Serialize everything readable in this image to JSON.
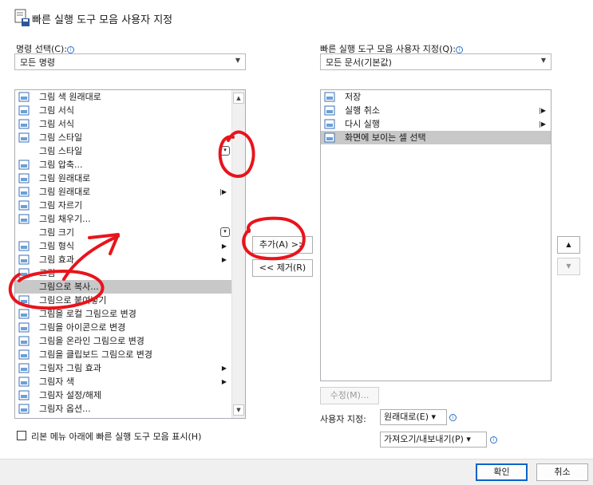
{
  "dialog": {
    "title": "빠른 실행 도구 모음 사용자 지정"
  },
  "left": {
    "label": "명령 선택(C):",
    "dropdown_value": "모든 명령",
    "items": [
      {
        "label": "그림 색 원래대로",
        "icon": "picture-reset-icon",
        "sub": ""
      },
      {
        "label": "그림 서식",
        "icon": "picture-format-icon",
        "sub": ""
      },
      {
        "label": "그림 서식",
        "icon": "format-painter-icon",
        "sub": ""
      },
      {
        "label": "그림 스타일",
        "icon": "picture-style-icon",
        "sub": ""
      },
      {
        "label": "그림 스타일",
        "icon": "",
        "sub": "drop"
      },
      {
        "label": "그림 압축...",
        "icon": "compress-picture-icon",
        "sub": ""
      },
      {
        "label": "그림 원래대로",
        "icon": "picture-reset-icon",
        "sub": ""
      },
      {
        "label": "그림 원래대로",
        "icon": "picture-reset-icon",
        "sub": "split"
      },
      {
        "label": "그림 자르기",
        "icon": "crop-icon",
        "sub": ""
      },
      {
        "label": "그림 채우기...",
        "icon": "picture-fill-icon",
        "sub": ""
      },
      {
        "label": "그림 크기",
        "icon": "",
        "sub": "drop"
      },
      {
        "label": "그림 형식",
        "icon": "picture-layout-icon",
        "sub": "arrow"
      },
      {
        "label": "그림 효과",
        "icon": "picture-effects-icon",
        "sub": "arrow"
      },
      {
        "label": "그림",
        "icon": "picture-icon",
        "sub": ""
      },
      {
        "label": "그림으로 복사...",
        "icon": "",
        "sub": ""
      },
      {
        "label": "그림으로 붙여넣기",
        "icon": "paste-picture-icon",
        "sub": ""
      },
      {
        "label": "그림을 로컬 그림으로 변경",
        "icon": "change-local-picture-icon",
        "sub": ""
      },
      {
        "label": "그림을 아이콘으로 변경",
        "icon": "change-icon-icon",
        "sub": ""
      },
      {
        "label": "그림을 온라인 그림으로 변경",
        "icon": "change-online-picture-icon",
        "sub": ""
      },
      {
        "label": "그림을 클립보드 그림으로 변경",
        "icon": "change-clipboard-picture-icon",
        "sub": ""
      },
      {
        "label": "그림자 그림 효과",
        "icon": "shadow-effect-icon",
        "sub": "arrow"
      },
      {
        "label": "그림자 색",
        "icon": "shadow-color-icon",
        "sub": "arrow"
      },
      {
        "label": "그림자 설정/해제",
        "icon": "shadow-toggle-icon",
        "sub": ""
      },
      {
        "label": "그림자 옵션...",
        "icon": "shadow-options-icon",
        "sub": ""
      }
    ],
    "selected_index": 14,
    "show_below_ribbon": "리본 메뉴 아래에 빠른 실행 도구 모음 표시(H)"
  },
  "right": {
    "label": "빠른 실행 도구 모음 사용자 지정(Q):",
    "dropdown_value": "모든 문서(기본값)",
    "items": [
      {
        "label": "저장",
        "icon": "save-icon",
        "sub": ""
      },
      {
        "label": "실행 취소",
        "icon": "undo-icon",
        "sub": "split"
      },
      {
        "label": "다시 실행",
        "icon": "redo-icon",
        "sub": "split"
      },
      {
        "label": "화면에 보이는 셀 선택",
        "icon": "select-visible-cells-icon",
        "sub": ""
      }
    ],
    "selected_index": 3
  },
  "buttons": {
    "add": "추가(A) >>",
    "remove": "<< 제거(R)",
    "modify": "수정(M)...",
    "ok": "확인",
    "cancel": "취소",
    "move_up": "▲",
    "move_down": "▼"
  },
  "customize": {
    "label": "사용자 지정:",
    "reset": "원래대로(E) ▾",
    "import_export": "가져오기/내보내기(P) ▾"
  },
  "colors": {
    "selection": "#c8c8c8",
    "accent": "#0a64c8",
    "annotation": "#e8141c"
  }
}
